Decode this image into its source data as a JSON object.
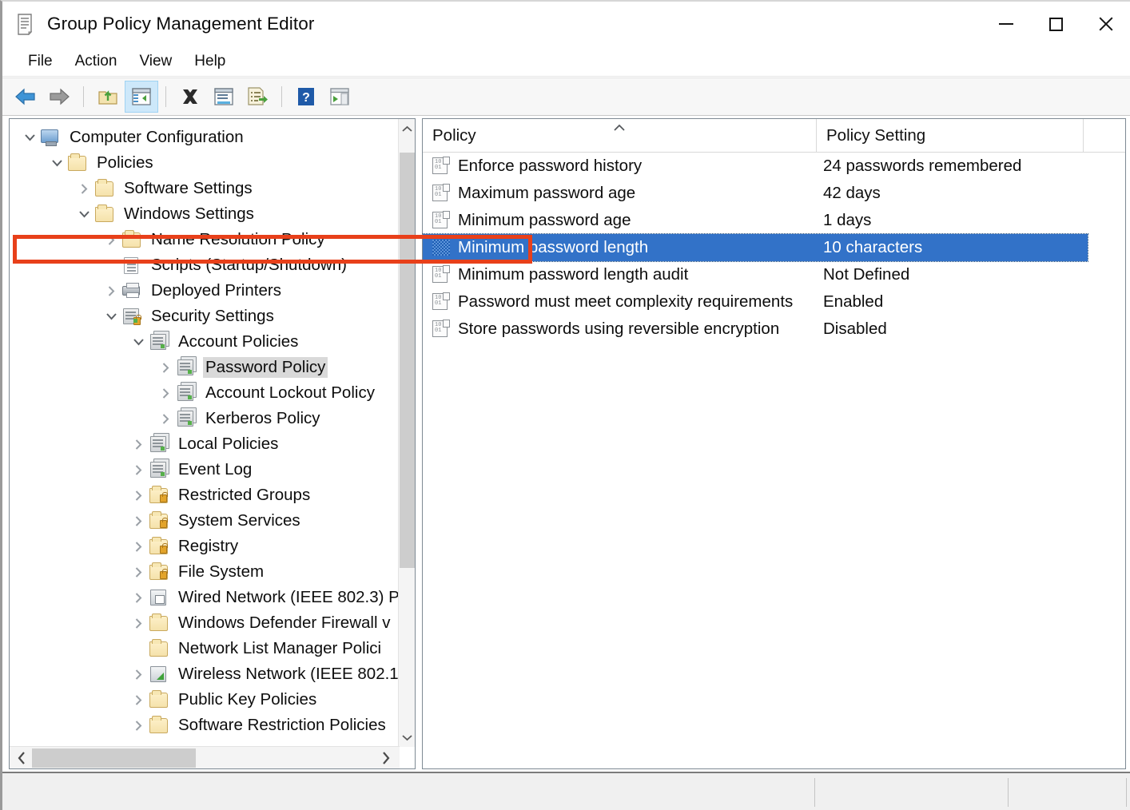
{
  "window": {
    "title": "Group Policy Management Editor",
    "icon": "policy-scroll-icon",
    "controls": {
      "minimize": "minimize-button",
      "maximize": "maximize-button",
      "close": "close-button"
    }
  },
  "menu": {
    "items": [
      {
        "label": "File"
      },
      {
        "label": "Action"
      },
      {
        "label": "View"
      },
      {
        "label": "Help"
      }
    ]
  },
  "toolbar": {
    "buttons": [
      {
        "name": "back-icon",
        "tooltip": "Back"
      },
      {
        "name": "forward-icon",
        "tooltip": "Forward"
      },
      {
        "name": "up-one-level-icon",
        "tooltip": "Up One Level"
      },
      {
        "name": "show-hide-console-tree-icon",
        "tooltip": "Show/Hide Console Tree",
        "active": true
      },
      {
        "name": "delete-icon",
        "tooltip": "Delete"
      },
      {
        "name": "properties-icon",
        "tooltip": "Properties"
      },
      {
        "name": "export-list-icon",
        "tooltip": "Export List"
      },
      {
        "name": "help-icon",
        "tooltip": "Help"
      },
      {
        "name": "show-hide-action-pane-icon",
        "tooltip": "Show/Hide Action Pane"
      }
    ]
  },
  "tree": {
    "nodes": [
      {
        "label": "Computer Configuration",
        "indent": 0,
        "twisty": "down",
        "icon": "computer-icon",
        "selected": false
      },
      {
        "label": "Policies",
        "indent": 1,
        "twisty": "down",
        "icon": "folder-icon",
        "selected": false
      },
      {
        "label": "Software Settings",
        "indent": 2,
        "twisty": "right",
        "icon": "folder-icon",
        "selected": false
      },
      {
        "label": "Windows Settings",
        "indent": 2,
        "twisty": "down",
        "icon": "folder-icon",
        "selected": false
      },
      {
        "label": "Name Resolution Policy",
        "indent": 3,
        "twisty": "right",
        "icon": "folder-icon",
        "selected": false
      },
      {
        "label": "Scripts (Startup/Shutdown)",
        "indent": 3,
        "twisty": "none",
        "icon": "script-icon",
        "selected": false
      },
      {
        "label": "Deployed Printers",
        "indent": 3,
        "twisty": "right",
        "icon": "printer-icon",
        "selected": false
      },
      {
        "label": "Security Settings",
        "indent": 3,
        "twisty": "down",
        "icon": "security-icon",
        "selected": false
      },
      {
        "label": "Account Policies",
        "indent": 4,
        "twisty": "down",
        "icon": "server-icon",
        "selected": false
      },
      {
        "label": "Password Policy",
        "indent": 5,
        "twisty": "right",
        "icon": "server-icon",
        "selected": true
      },
      {
        "label": "Account Lockout Policy",
        "indent": 5,
        "twisty": "right",
        "icon": "server-icon",
        "selected": false
      },
      {
        "label": "Kerberos Policy",
        "indent": 5,
        "twisty": "right",
        "icon": "server-icon",
        "selected": false
      },
      {
        "label": "Local Policies",
        "indent": 4,
        "twisty": "right",
        "icon": "server-icon",
        "selected": false
      },
      {
        "label": "Event Log",
        "indent": 4,
        "twisty": "right",
        "icon": "server-icon",
        "selected": false
      },
      {
        "label": "Restricted Groups",
        "indent": 4,
        "twisty": "right",
        "icon": "folder-lock-icon",
        "selected": false
      },
      {
        "label": "System Services",
        "indent": 4,
        "twisty": "right",
        "icon": "folder-lock-icon",
        "selected": false
      },
      {
        "label": "Registry",
        "indent": 4,
        "twisty": "right",
        "icon": "folder-lock-icon",
        "selected": false
      },
      {
        "label": "File System",
        "indent": 4,
        "twisty": "right",
        "icon": "folder-lock-icon",
        "selected": false
      },
      {
        "label": "Wired Network (IEEE 802.3) P",
        "indent": 4,
        "twisty": "right",
        "icon": "wired-network-icon",
        "selected": false
      },
      {
        "label": "Windows Defender Firewall ᴠ",
        "indent": 4,
        "twisty": "right",
        "icon": "folder-icon",
        "selected": false
      },
      {
        "label": "Network List Manager Polici",
        "indent": 4,
        "twisty": "none",
        "icon": "folder-icon",
        "selected": false
      },
      {
        "label": "Wireless Network (IEEE 802.1",
        "indent": 4,
        "twisty": "right",
        "icon": "wireless-network-icon",
        "selected": false
      },
      {
        "label": "Public Key Policies",
        "indent": 4,
        "twisty": "right",
        "icon": "folder-icon",
        "selected": false
      },
      {
        "label": "Software Restriction Policies",
        "indent": 4,
        "twisty": "right",
        "icon": "folder-icon",
        "selected": false
      }
    ]
  },
  "listview": {
    "columns": [
      "Policy",
      "Policy Setting",
      ""
    ],
    "sort_indicator": "ascending-caret",
    "rows": [
      {
        "policy": "Enforce password history",
        "setting": "24 passwords remembered",
        "selected": false
      },
      {
        "policy": "Maximum password age",
        "setting": "42 days",
        "selected": false
      },
      {
        "policy": "Minimum password age",
        "setting": "1 days",
        "selected": false
      },
      {
        "policy": "Minimum password length",
        "setting": "10 characters",
        "selected": true
      },
      {
        "policy": "Minimum password length audit",
        "setting": "Not Defined",
        "selected": false
      },
      {
        "policy": "Password must meet complexity requirements",
        "setting": "Enabled",
        "selected": false
      },
      {
        "policy": "Store passwords using reversible encryption",
        "setting": "Disabled",
        "selected": false
      }
    ]
  },
  "annotation": {
    "highlight_color": "#e8401a",
    "target_row": "Minimum password length"
  },
  "colors": {
    "selection_blue": "#3272c8",
    "tree_selection_gray": "#d9d9d9",
    "toolbar_active": "#cde8fa",
    "window_background": "#ffffff"
  }
}
